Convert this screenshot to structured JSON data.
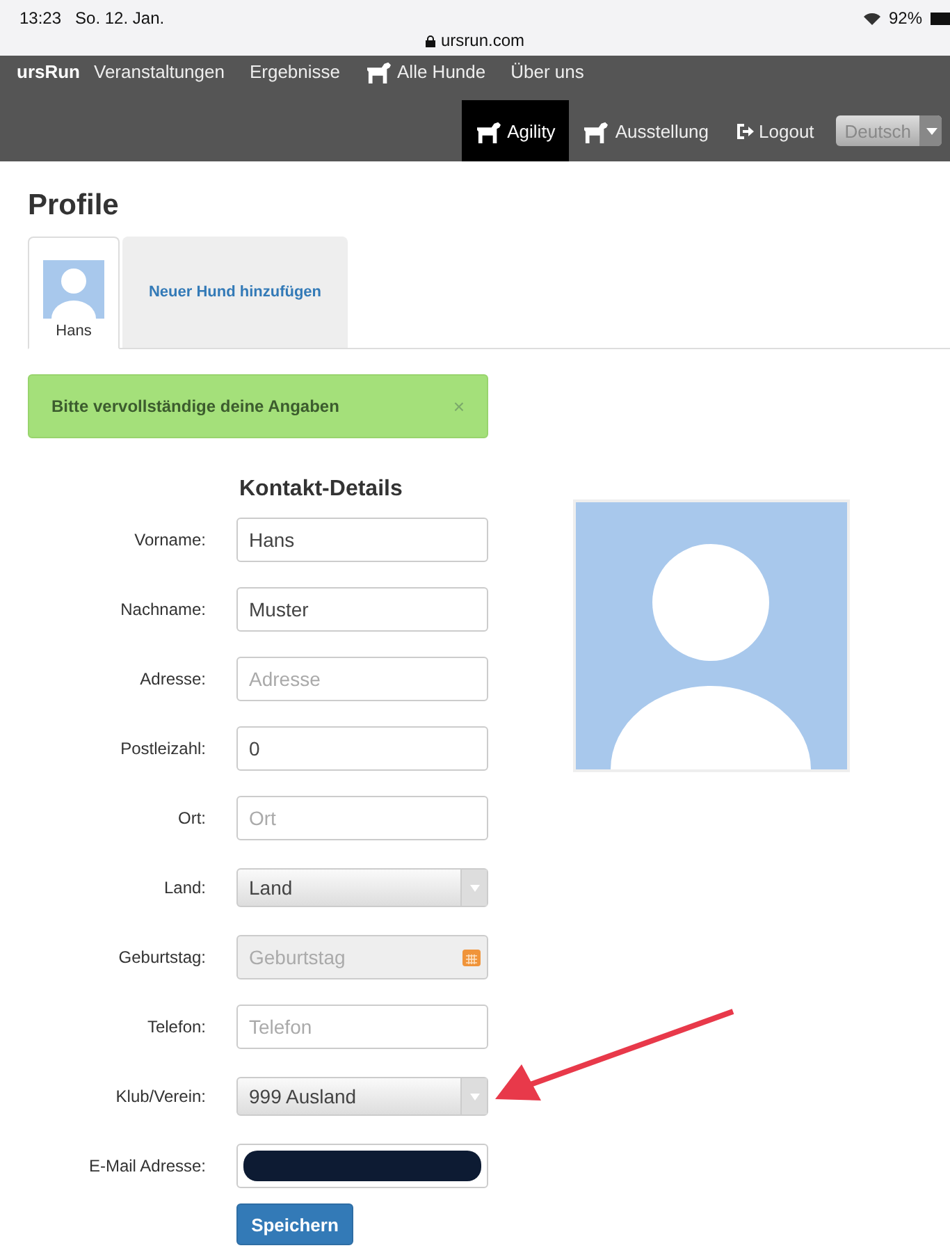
{
  "status_bar": {
    "time": "13:23",
    "date": "So. 12. Jan.",
    "battery": "92%"
  },
  "address_bar": {
    "url": "ursrun.com"
  },
  "nav": {
    "brand": "ursRun",
    "items": [
      {
        "label": "Veranstaltungen",
        "icon": false
      },
      {
        "label": "Ergebnisse",
        "icon": false
      },
      {
        "label": "Alle Hunde",
        "icon": true
      },
      {
        "label": "Über uns",
        "icon": false
      }
    ],
    "right_items": [
      {
        "label": "Agility",
        "kind": "dog",
        "selected": true
      },
      {
        "label": "Ausstellung",
        "kind": "dog",
        "selected": false
      },
      {
        "label": "Logout",
        "kind": "logout",
        "selected": false
      }
    ],
    "language": "Deutsch"
  },
  "title": "Profile",
  "tabs": [
    {
      "label": "Hans",
      "kind": "avatar",
      "selected": true
    },
    {
      "label": "Neuer Hund hinzufügen",
      "kind": "link",
      "selected": false
    }
  ],
  "alert": {
    "text": "Bitte vervollständige deine Angaben",
    "close": "×"
  },
  "form": {
    "heading": "Kontakt-Details",
    "fields": [
      {
        "label": "Vorname:",
        "kind": "text",
        "value": "Hans"
      },
      {
        "label": "Nachname:",
        "kind": "text",
        "value": "Muster"
      },
      {
        "label": "Adresse:",
        "kind": "text",
        "placeholder": "Adresse"
      },
      {
        "label": "Postleizahl:",
        "kind": "text",
        "value": "0"
      },
      {
        "label": "Ort:",
        "kind": "text",
        "placeholder": "Ort"
      },
      {
        "label": "Land:",
        "kind": "select",
        "value": "Land"
      },
      {
        "label": "Geburtstag:",
        "kind": "date",
        "placeholder": "Geburtstag"
      },
      {
        "label": "Telefon:",
        "kind": "text",
        "placeholder": "Telefon"
      },
      {
        "label": "Klub/Verein:",
        "kind": "select",
        "value": "999 Ausland"
      },
      {
        "label": "E-Mail Adresse:",
        "kind": "redacted"
      }
    ],
    "submit": "Speichern"
  }
}
